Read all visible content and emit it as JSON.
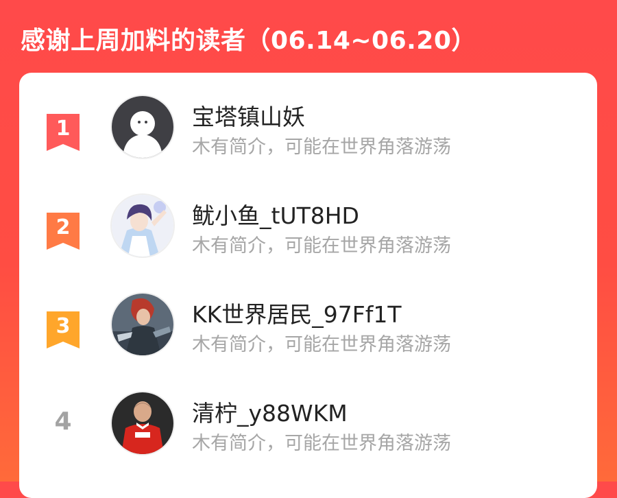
{
  "header": {
    "title": "感谢上周加料的读者（06.14~06.20）"
  },
  "colors": {
    "background": "#ff4a4a",
    "rank1": "#ff5a5a",
    "rank2": "#ff7a45",
    "rank3": "#ffa62b",
    "rank_plain": "#a3a3a3"
  },
  "readers": [
    {
      "rank": "1",
      "name": "宝塔镇山妖",
      "bio": "木有简介，可能在世界角落游荡",
      "avatar": "default-ghost-avatar"
    },
    {
      "rank": "2",
      "name": "鱿小鱼_tUT8HD",
      "bio": "木有简介，可能在世界角落游荡",
      "avatar": "anime-boy-avatar"
    },
    {
      "rank": "3",
      "name": "KK世界居民_97Ff1T",
      "bio": "木有简介，可能在世界角落游荡",
      "avatar": "anime-warrior-avatar"
    },
    {
      "rank": "4",
      "name": "清柠_y88WKM",
      "bio": "木有简介，可能在世界角落游荡",
      "avatar": "football-player-avatar"
    }
  ]
}
